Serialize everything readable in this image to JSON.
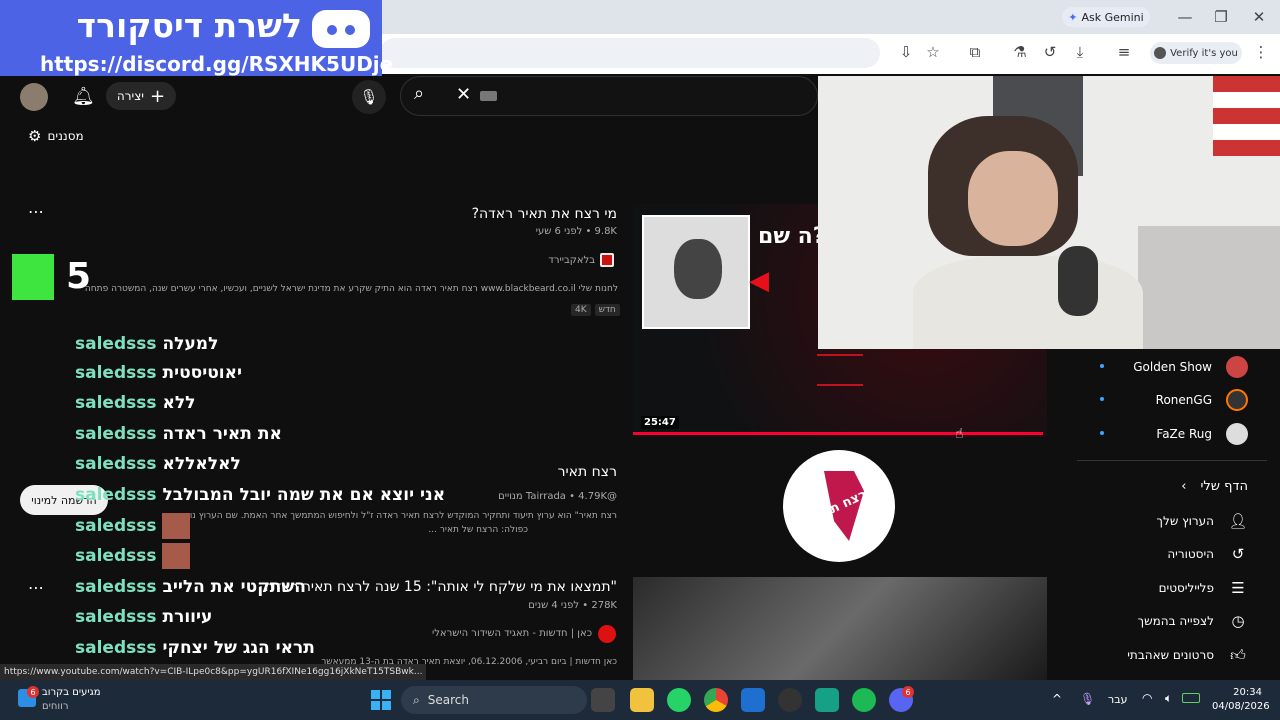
{
  "browser": {
    "gemini_label": "Ask Gemini",
    "verify_label": "Verify it's you",
    "status_url": "https://www.youtube.com/watch?v=CIB-ILpe0c8&pp=ygUR16fXINe16gg16jXkNeT15TSBwk..."
  },
  "discord": {
    "title": "לשרת דיסקורד",
    "link": "https://discord.gg/RSXHK5UDje"
  },
  "header": {
    "create_label": "יצירה",
    "filters_label": "מסננים"
  },
  "results": [
    {
      "title": "מי רצח את תאיר ראדה?",
      "meta": "9.8K • לפני 6 שעי",
      "channel": "בלאקביירד",
      "desc": "לחנות שלי www.blackbeard.co.il רצח תאיר ראדה הוא התיק שקרע את מדינת ישראל לשניים, ועכשיו, אחרי עשרים שנה, המשטרה פתחה",
      "badges": [
        "4K",
        "חדש"
      ],
      "duration": "25:47",
      "thumb_text": "ה שם?"
    },
    {
      "title": "רצח תאיר",
      "meta": "@Tairrada • 4.79K מנויים",
      "desc1": "רצח תאיר\" הוא ערוץ תיעוד ותחקיר המוקדש לרצח תאיר ראדה ז\"ל ולחיפוש המתמשך אחר האמת. שם הערוץ נושא",
      "desc2": "כפולה: הרצח של תאיר ...",
      "logo_text": "רצח תאיר"
    },
    {
      "title": "\"תמצאו את מי שלקח לי אותה\": 15 שנה לרצח תאיר ראדה",
      "meta": "278K • לפני 4 שנים",
      "channel": "כאן | חדשות - תאגיד השידור הישראלי",
      "desc": "כאן חדשות | ביום רביעי, 06.12.2006, יוצאת תאיר ראדה בת ה-13 ממעאשר"
    }
  ],
  "chat": [
    {
      "user": "saledsss",
      "msg": "למעלה"
    },
    {
      "user": "saledsss",
      "msg": "יאוטיסטית"
    },
    {
      "user": "saledsss",
      "msg": "ללא"
    },
    {
      "user": "saledsss",
      "msg": "את תאיר ראדה"
    },
    {
      "user": "saledsss",
      "msg": "לאלאללא"
    },
    {
      "user": "saledsss",
      "msg": "אני יוצא אם את שמה יובל המבולבל"
    },
    {
      "user": "saledsss",
      "msg": ""
    },
    {
      "user": "saledsss",
      "msg": ""
    },
    {
      "user": "saledsss",
      "msg": "השתקטי את הלייב"
    },
    {
      "user": "saledsss",
      "msg": "עיוורת"
    },
    {
      "user": "saledsss",
      "msg": "תראי הגג של יצחקי"
    }
  ],
  "subscribe_pill": "הרשמה למינוי",
  "sidebar": {
    "subscriptions": [
      "Golden Show",
      "RonenGG",
      "FaZe Rug"
    ],
    "you_heading": "הדף שלי",
    "items": [
      "הערוץ שלך",
      "היסטוריה",
      "פלייליסטים",
      "לצפייה בהמשך",
      "סרטונים שאהבתי"
    ]
  },
  "k5": "5",
  "taskbar": {
    "weather_temp": "מגיעים בקרוב",
    "weather_sub": "רווחים",
    "search": "Search",
    "lang": "עבר",
    "time": "20:34",
    "date": "04/08/2026",
    "badge_weather": "6",
    "badge_discord": "6"
  }
}
